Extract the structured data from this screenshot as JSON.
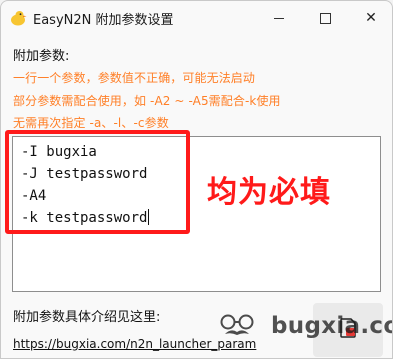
{
  "window": {
    "title": "EasyN2N 附加参数设置",
    "app_icon": "duck-icon",
    "controls": {
      "minimize": "minimize-icon",
      "maximize": "maximize-icon",
      "close": "✕"
    }
  },
  "form": {
    "section_label": "附加参数:",
    "hints": [
      "一行一个参数，参数值不正确，可能无法启动",
      "部分参数需配合使用，如 -A2 ~ -A5需配合-k使用",
      "无需再次指定 -a、-l、-c参数"
    ],
    "params_lines": [
      "-I bugxia",
      "-J testpassword",
      "-A4",
      "-k testpassword"
    ]
  },
  "annotation": {
    "text": "均为必填",
    "color": "#ff1a1a"
  },
  "footer": {
    "label": "附加参数具体介绍见这里:",
    "link": "https://bugxia.com/n2n_launcher_param"
  },
  "watermark": {
    "text": "bugxia.com"
  },
  "colors": {
    "hint": "#ff7f27",
    "highlight": "#ff1a1a"
  }
}
